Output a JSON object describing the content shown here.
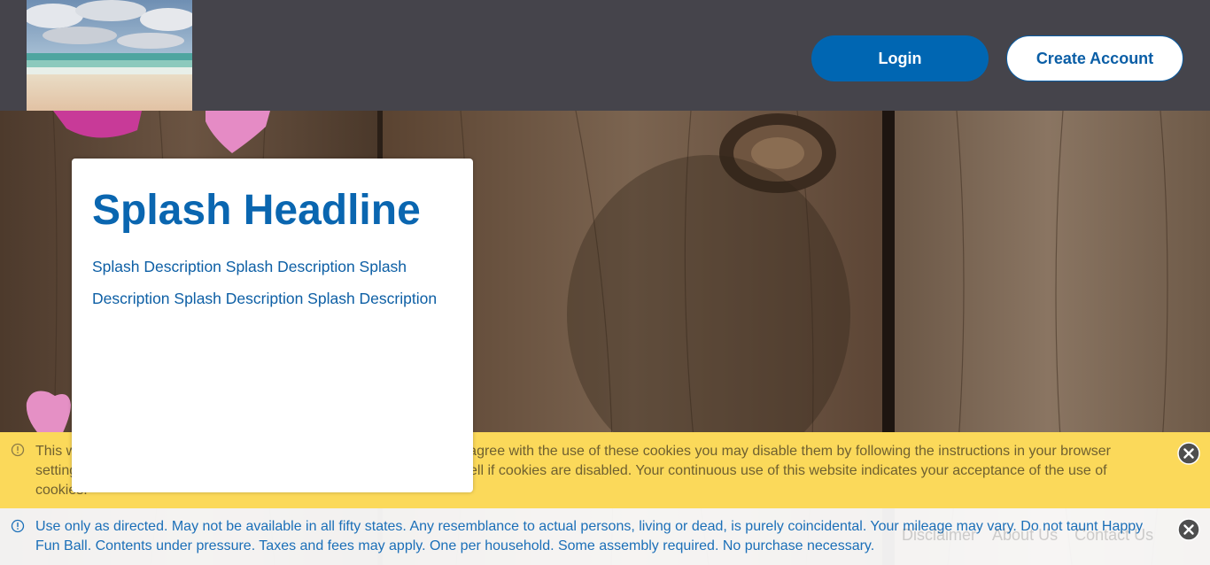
{
  "header": {
    "login_label": "Login",
    "create_account_label": "Create Account"
  },
  "splash": {
    "headline": "Splash Headline",
    "description": "Splash Description Splash Description Splash Description Splash Description Splash Description"
  },
  "cookie_banner": {
    "text": "This website uses cookies to enhance your experience. If you do not agree with the use of these cookies you may disable them by following the instructions in your browser settings. Please note that some of the services may not function as well if cookies are disabled. Your continuous use of this website indicates your acceptance of the use of cookies.",
    "icon": "info-circle-icon",
    "close_icon": "close-circle-icon"
  },
  "notice_banner": {
    "text": "Use only as directed. May not be available in all fifty states. Any resemblance to actual persons, living or dead, is purely coincidental. Your mileage may vary. Do not taunt Happy Fun Ball. Contents under pressure. Taxes and fees may apply. One per household. Some assembly required. No purchase necessary.",
    "icon": "info-circle-icon",
    "close_icon": "close-circle-icon"
  },
  "footer": {
    "links": [
      "Disclaimer",
      "About Us",
      "Contact Us"
    ]
  },
  "colors": {
    "header_bg": "#45444b",
    "primary": "#0066b2",
    "cookie_bg": "#fbd95a",
    "notice_text": "#1b6fb8"
  }
}
